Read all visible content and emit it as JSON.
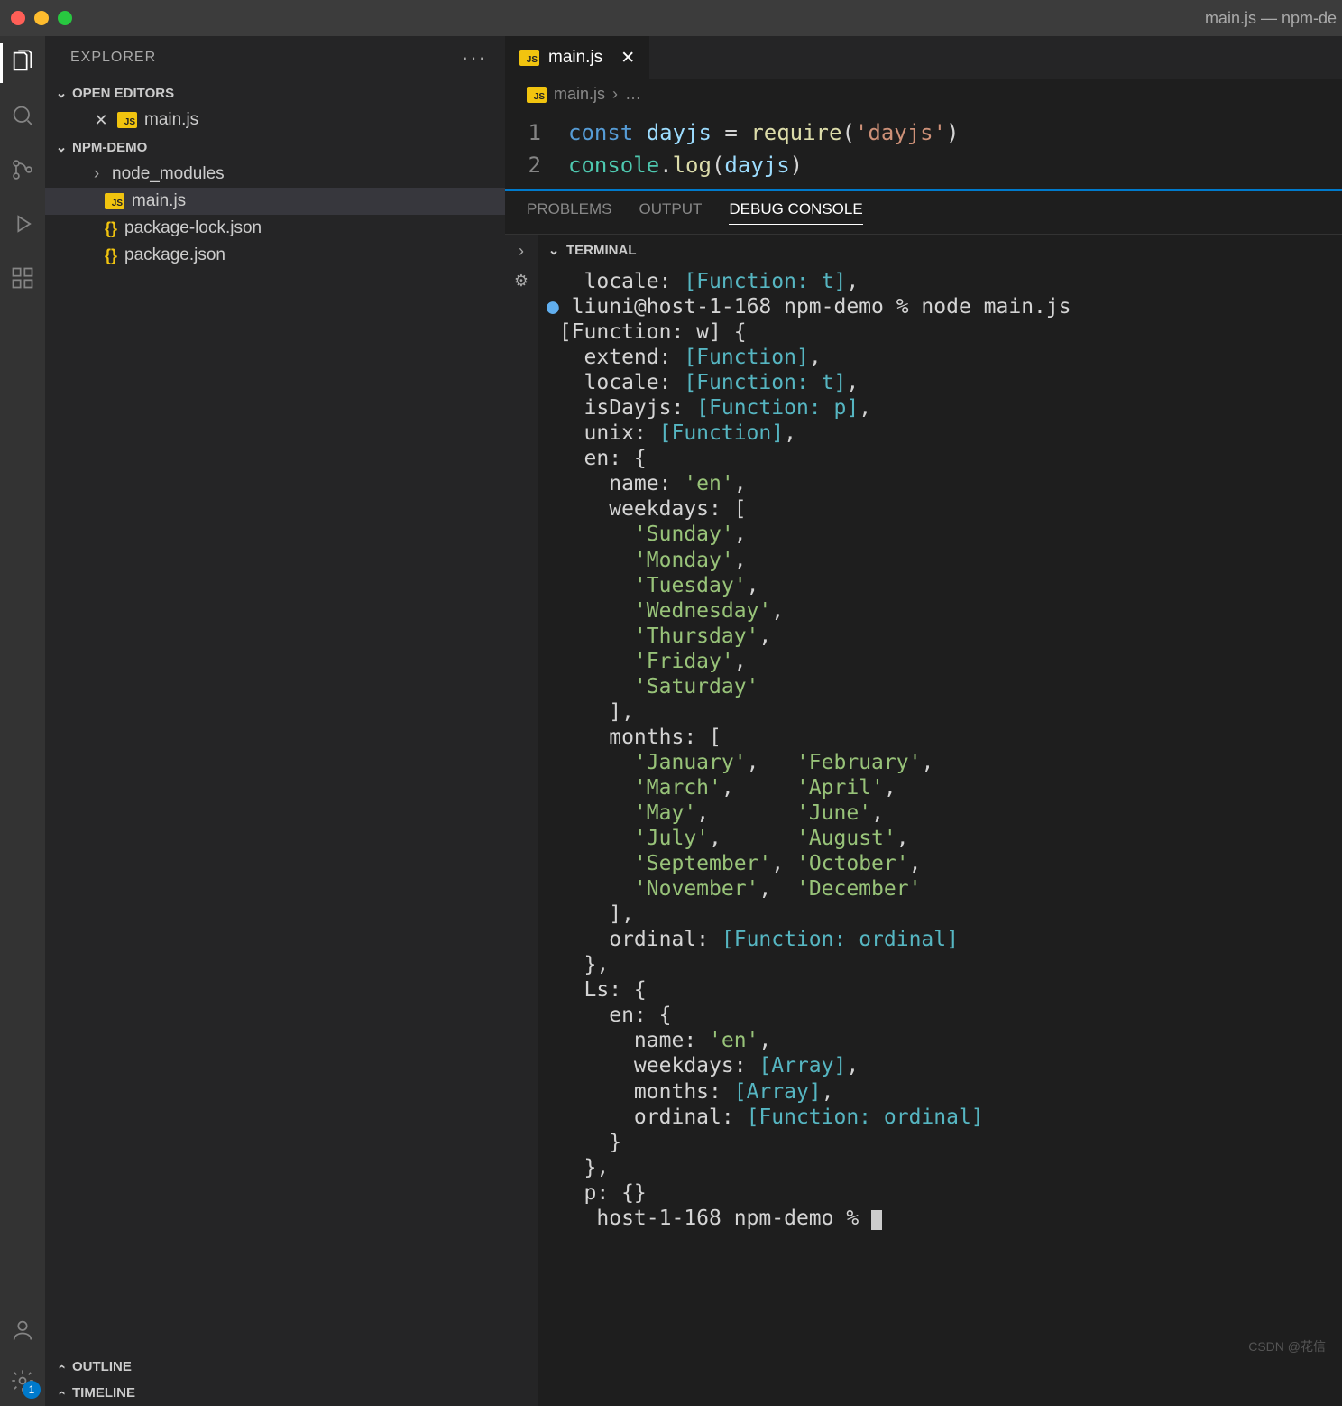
{
  "window": {
    "title": "main.js — npm-de"
  },
  "sidebar": {
    "title": "EXPLORER",
    "openEditors": {
      "label": "OPEN EDITORS",
      "items": [
        {
          "name": "main.js",
          "icon": "js"
        }
      ]
    },
    "folder": {
      "label": "NPM-DEMO",
      "items": [
        {
          "name": "node_modules",
          "type": "folder"
        },
        {
          "name": "main.js",
          "type": "js",
          "active": true
        },
        {
          "name": "package-lock.json",
          "type": "json"
        },
        {
          "name": "package.json",
          "type": "json"
        }
      ]
    },
    "outline": "OUTLINE",
    "timeline": "TIMELINE"
  },
  "activity": {
    "badge": "1"
  },
  "tabs": [
    {
      "name": "main.js"
    }
  ],
  "breadcrumb": {
    "file": "main.js",
    "rest": "…"
  },
  "code": {
    "lines": [
      {
        "n": "1",
        "tokens": [
          {
            "t": "const ",
            "c": "tok-const"
          },
          {
            "t": "dayjs",
            "c": "tok-var"
          },
          {
            "t": " = ",
            "c": "tok-default"
          },
          {
            "t": "require",
            "c": "tok-func"
          },
          {
            "t": "(",
            "c": "tok-default"
          },
          {
            "t": "'dayjs'",
            "c": "tok-string"
          },
          {
            "t": ")",
            "c": "tok-default"
          }
        ]
      },
      {
        "n": "2",
        "tokens": [
          {
            "t": "console",
            "c": "tok-obj"
          },
          {
            "t": ".",
            "c": "tok-default"
          },
          {
            "t": "log",
            "c": "tok-func"
          },
          {
            "t": "(",
            "c": "tok-default"
          },
          {
            "t": "dayjs",
            "c": "tok-var"
          },
          {
            "t": ")",
            "c": "tok-default"
          }
        ]
      }
    ]
  },
  "panel": {
    "tabs": [
      "PROBLEMS",
      "OUTPUT",
      "DEBUG CONSOLE"
    ],
    "activeTab": 2,
    "terminalLabel": "TERMINAL"
  },
  "terminal": {
    "lines": [
      [
        {
          "t": "   locale: ",
          "c": "t-white"
        },
        {
          "t": "[Function: t]",
          "c": "t-cyan"
        },
        {
          "t": ",",
          "c": "t-white"
        }
      ],
      [
        {
          "t": "● ",
          "c": "prompt-dot"
        },
        {
          "t": "liuni@host-1-168 npm-demo % node main.js",
          "c": "t-white"
        }
      ],
      [
        {
          "t": " [Function: w] {",
          "c": "t-white"
        }
      ],
      [
        {
          "t": "   extend: ",
          "c": "t-white"
        },
        {
          "t": "[Function]",
          "c": "t-cyan"
        },
        {
          "t": ",",
          "c": "t-white"
        }
      ],
      [
        {
          "t": "   locale: ",
          "c": "t-white"
        },
        {
          "t": "[Function: t]",
          "c": "t-cyan"
        },
        {
          "t": ",",
          "c": "t-white"
        }
      ],
      [
        {
          "t": "   isDayjs: ",
          "c": "t-white"
        },
        {
          "t": "[Function: p]",
          "c": "t-cyan"
        },
        {
          "t": ",",
          "c": "t-white"
        }
      ],
      [
        {
          "t": "   unix: ",
          "c": "t-white"
        },
        {
          "t": "[Function]",
          "c": "t-cyan"
        },
        {
          "t": ",",
          "c": "t-white"
        }
      ],
      [
        {
          "t": "   en: {",
          "c": "t-white"
        }
      ],
      [
        {
          "t": "     name: ",
          "c": "t-white"
        },
        {
          "t": "'en'",
          "c": "t-green"
        },
        {
          "t": ",",
          "c": "t-white"
        }
      ],
      [
        {
          "t": "     weekdays: [",
          "c": "t-white"
        }
      ],
      [
        {
          "t": "       ",
          "c": "t-white"
        },
        {
          "t": "'Sunday'",
          "c": "t-green"
        },
        {
          "t": ",",
          "c": "t-white"
        }
      ],
      [
        {
          "t": "       ",
          "c": "t-white"
        },
        {
          "t": "'Monday'",
          "c": "t-green"
        },
        {
          "t": ",",
          "c": "t-white"
        }
      ],
      [
        {
          "t": "       ",
          "c": "t-white"
        },
        {
          "t": "'Tuesday'",
          "c": "t-green"
        },
        {
          "t": ",",
          "c": "t-white"
        }
      ],
      [
        {
          "t": "       ",
          "c": "t-white"
        },
        {
          "t": "'Wednesday'",
          "c": "t-green"
        },
        {
          "t": ",",
          "c": "t-white"
        }
      ],
      [
        {
          "t": "       ",
          "c": "t-white"
        },
        {
          "t": "'Thursday'",
          "c": "t-green"
        },
        {
          "t": ",",
          "c": "t-white"
        }
      ],
      [
        {
          "t": "       ",
          "c": "t-white"
        },
        {
          "t": "'Friday'",
          "c": "t-green"
        },
        {
          "t": ",",
          "c": "t-white"
        }
      ],
      [
        {
          "t": "       ",
          "c": "t-white"
        },
        {
          "t": "'Saturday'",
          "c": "t-green"
        }
      ],
      [
        {
          "t": "     ],",
          "c": "t-white"
        }
      ],
      [
        {
          "t": "     months: [",
          "c": "t-white"
        }
      ],
      [
        {
          "t": "       ",
          "c": "t-white"
        },
        {
          "t": "'January'",
          "c": "t-green"
        },
        {
          "t": ",   ",
          "c": "t-white"
        },
        {
          "t": "'February'",
          "c": "t-green"
        },
        {
          "t": ",",
          "c": "t-white"
        }
      ],
      [
        {
          "t": "       ",
          "c": "t-white"
        },
        {
          "t": "'March'",
          "c": "t-green"
        },
        {
          "t": ",     ",
          "c": "t-white"
        },
        {
          "t": "'April'",
          "c": "t-green"
        },
        {
          "t": ",",
          "c": "t-white"
        }
      ],
      [
        {
          "t": "       ",
          "c": "t-white"
        },
        {
          "t": "'May'",
          "c": "t-green"
        },
        {
          "t": ",       ",
          "c": "t-white"
        },
        {
          "t": "'June'",
          "c": "t-green"
        },
        {
          "t": ",",
          "c": "t-white"
        }
      ],
      [
        {
          "t": "       ",
          "c": "t-white"
        },
        {
          "t": "'July'",
          "c": "t-green"
        },
        {
          "t": ",      ",
          "c": "t-white"
        },
        {
          "t": "'August'",
          "c": "t-green"
        },
        {
          "t": ",",
          "c": "t-white"
        }
      ],
      [
        {
          "t": "       ",
          "c": "t-white"
        },
        {
          "t": "'September'",
          "c": "t-green"
        },
        {
          "t": ", ",
          "c": "t-white"
        },
        {
          "t": "'October'",
          "c": "t-green"
        },
        {
          "t": ",",
          "c": "t-white"
        }
      ],
      [
        {
          "t": "       ",
          "c": "t-white"
        },
        {
          "t": "'November'",
          "c": "t-green"
        },
        {
          "t": ",  ",
          "c": "t-white"
        },
        {
          "t": "'December'",
          "c": "t-green"
        }
      ],
      [
        {
          "t": "     ],",
          "c": "t-white"
        }
      ],
      [
        {
          "t": "     ordinal: ",
          "c": "t-white"
        },
        {
          "t": "[Function: ordinal]",
          "c": "t-cyan"
        }
      ],
      [
        {
          "t": "   },",
          "c": "t-white"
        }
      ],
      [
        {
          "t": "   Ls: {",
          "c": "t-white"
        }
      ],
      [
        {
          "t": "     en: {",
          "c": "t-white"
        }
      ],
      [
        {
          "t": "       name: ",
          "c": "t-white"
        },
        {
          "t": "'en'",
          "c": "t-green"
        },
        {
          "t": ",",
          "c": "t-white"
        }
      ],
      [
        {
          "t": "       weekdays: ",
          "c": "t-white"
        },
        {
          "t": "[Array]",
          "c": "t-cyan"
        },
        {
          "t": ",",
          "c": "t-white"
        }
      ],
      [
        {
          "t": "       months: ",
          "c": "t-white"
        },
        {
          "t": "[Array]",
          "c": "t-cyan"
        },
        {
          "t": ",",
          "c": "t-white"
        }
      ],
      [
        {
          "t": "       ordinal: ",
          "c": "t-white"
        },
        {
          "t": "[Function: ordinal]",
          "c": "t-cyan"
        }
      ],
      [
        {
          "t": "     }",
          "c": "t-white"
        }
      ],
      [
        {
          "t": "   },",
          "c": "t-white"
        }
      ],
      [
        {
          "t": "   p: {}",
          "c": "t-white"
        }
      ]
    ],
    "prompt": "    host-1-168 npm-demo % "
  },
  "watermark": "CSDN @花信"
}
